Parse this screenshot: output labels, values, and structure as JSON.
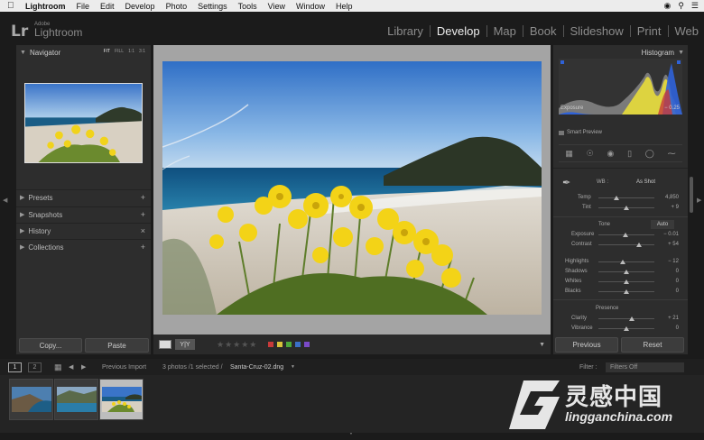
{
  "menubar": {
    "apple": "",
    "items": [
      "Lightroom",
      "File",
      "Edit",
      "Develop",
      "Photo",
      "Settings",
      "Tools",
      "View",
      "Window",
      "Help"
    ],
    "right_icons": [
      "cc-icon",
      "search-icon",
      "menu-list-icon"
    ]
  },
  "identity": {
    "logo": "Lr",
    "brand_small": "Adobe",
    "brand_big": "Lightroom"
  },
  "modules": [
    {
      "label": "Library",
      "active": false
    },
    {
      "label": "Develop",
      "active": true
    },
    {
      "label": "Map",
      "active": false
    },
    {
      "label": "Book",
      "active": false
    },
    {
      "label": "Slideshow",
      "active": false
    },
    {
      "label": "Print",
      "active": false
    },
    {
      "label": "Web",
      "active": false
    }
  ],
  "left_panel": {
    "navigator": "Navigator",
    "zoom": [
      "FIT",
      "FILL",
      "1:1",
      "3:1"
    ],
    "sections": [
      {
        "label": "Presets",
        "action": "+"
      },
      {
        "label": "Snapshots",
        "action": "+"
      },
      {
        "label": "History",
        "action": "×"
      },
      {
        "label": "Collections",
        "action": "+"
      }
    ],
    "copy": "Copy...",
    "paste": "Paste"
  },
  "toolbar": {
    "yy": "Y|Y",
    "stars": "★★★★★",
    "colors": [
      "#c83a3a",
      "#d8c23a",
      "#4ca83a",
      "#3a6fc8",
      "#7a4ac8"
    ]
  },
  "right_panel": {
    "histogram": "Histogram",
    "exposure_label": "Exposure",
    "exposure_value": "− 0.25",
    "smart_preview": "Smart Preview",
    "wb_label": "WB :",
    "wb_value": "As Shot",
    "temp_label": "Temp",
    "temp_value": "4,850",
    "tint_label": "Tint",
    "tint_value": "+ 9",
    "tone_label": "Tone",
    "auto": "Auto",
    "sliders": [
      {
        "label": "Exposure",
        "value": "− 0.01",
        "pos": 0.49
      },
      {
        "label": "Contrast",
        "value": "+ 54",
        "pos": 0.72
      },
      {
        "label": "Highlights",
        "value": "− 12",
        "pos": 0.44
      },
      {
        "label": "Shadows",
        "value": "0",
        "pos": 0.5
      },
      {
        "label": "Whites",
        "value": "0",
        "pos": 0.5
      },
      {
        "label": "Blacks",
        "value": "0",
        "pos": 0.5
      }
    ],
    "presence_label": "Presence",
    "presence": [
      {
        "label": "Clarity",
        "value": "+ 21",
        "pos": 0.6
      },
      {
        "label": "Vibrance",
        "value": "0",
        "pos": 0.5
      }
    ],
    "previous": "Previous",
    "reset": "Reset"
  },
  "filmstrip_bar": {
    "screen1": "1",
    "screen2": "2",
    "source": "Previous Import",
    "count": "3 photos /1 selected /",
    "filename": "Santa-Cruz-02.dng",
    "filter_label": "Filter :",
    "filter_value": "Filters Off"
  },
  "watermark": {
    "big": "灵感中国",
    "small": "lingganchina.com"
  }
}
